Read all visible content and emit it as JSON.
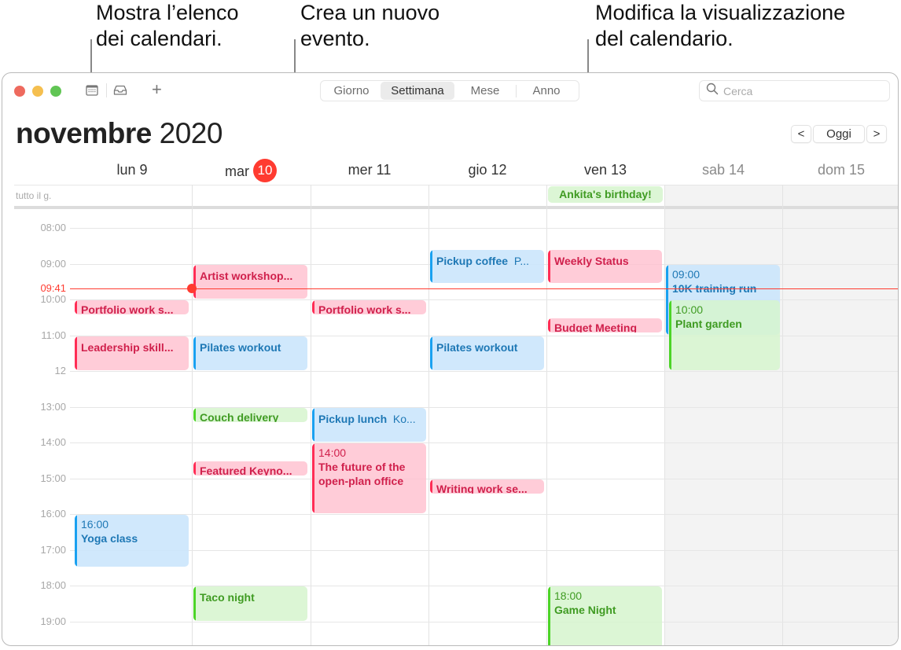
{
  "callouts": {
    "calendars_list": [
      "Mostra l’elenco",
      "dei calendari."
    ],
    "new_event": [
      "Crea un nuovo",
      "evento."
    ],
    "change_view": [
      "Modifica la visualizzazione",
      "del calendario."
    ]
  },
  "toolbar": {
    "calendars_icon": "calendar-list-icon",
    "inbox_icon": "inbox-tray-icon",
    "add_label": "+",
    "views": [
      "Giorno",
      "Settimana",
      "Mese",
      "Anno"
    ],
    "active_view": "Settimana",
    "search_placeholder": "Cerca"
  },
  "header": {
    "month": "novembre",
    "year": "2020",
    "prev_label": "<",
    "today_label": "Oggi",
    "next_label": ">"
  },
  "days": [
    {
      "name": "lun",
      "num": "9",
      "today": false,
      "weekend": false
    },
    {
      "name": "mar",
      "num": "10",
      "today": true,
      "weekend": false
    },
    {
      "name": "mer",
      "num": "11",
      "today": false,
      "weekend": false
    },
    {
      "name": "gio",
      "num": "12",
      "today": false,
      "weekend": false
    },
    {
      "name": "ven",
      "num": "13",
      "today": false,
      "weekend": false
    },
    {
      "name": "sab",
      "num": "14",
      "today": false,
      "weekend": true
    },
    {
      "name": "dom",
      "num": "15",
      "today": false,
      "weekend": true
    }
  ],
  "allday": {
    "label": "tutto il g.",
    "events": [
      {
        "day": 4,
        "title": "Ankita's birthday!",
        "color": "green"
      }
    ]
  },
  "hours": [
    "08:00",
    "09:00",
    "10:00",
    "11:00",
    "12",
    "13:00",
    "14:00",
    "15:00",
    "16:00",
    "17:00",
    "18:00",
    "19:00"
  ],
  "now": {
    "label": "09:41",
    "hour": 9.683
  },
  "colors": {
    "red": "#ff2d55",
    "blue": "#1aa1f0",
    "green": "#4cd427",
    "today": "#ff3b30"
  },
  "events": [
    {
      "day": 0,
      "start": 10.0,
      "end": 10.45,
      "title": "Portfolio work s...",
      "color": "red"
    },
    {
      "day": 0,
      "start": 11.0,
      "end": 12.0,
      "title": "Leadership skill...",
      "color": "red"
    },
    {
      "day": 0,
      "start": 16.0,
      "end": 17.5,
      "time": "16:00",
      "title": "Yoga class",
      "color": "blue"
    },
    {
      "day": 1,
      "start": 9.0,
      "end": 10.0,
      "title": "Artist workshop...",
      "color": "red"
    },
    {
      "day": 1,
      "start": 11.0,
      "end": 12.0,
      "title": "Pilates workout",
      "color": "blue"
    },
    {
      "day": 1,
      "start": 13.0,
      "end": 13.45,
      "title": "Couch delivery",
      "color": "green"
    },
    {
      "day": 1,
      "start": 14.5,
      "end": 14.95,
      "title": "Featured Keyno...",
      "color": "red"
    },
    {
      "day": 1,
      "start": 18.0,
      "end": 19.0,
      "title": "Taco night",
      "color": "green"
    },
    {
      "day": 2,
      "start": 10.0,
      "end": 10.45,
      "title": "Portfolio work s...",
      "color": "red"
    },
    {
      "day": 2,
      "start": 13.0,
      "end": 14.0,
      "title": "Pickup lunch",
      "location": "Ko...",
      "color": "blue"
    },
    {
      "day": 2,
      "start": 14.0,
      "end": 16.0,
      "time": "14:00",
      "title": "The future of the open-plan office",
      "color": "red",
      "wrap": true
    },
    {
      "day": 3,
      "start": 8.6,
      "end": 9.55,
      "title": "Pickup coffee",
      "location": "P...",
      "color": "blue"
    },
    {
      "day": 3,
      "start": 11.0,
      "end": 12.0,
      "title": "Pilates workout",
      "color": "blue"
    },
    {
      "day": 3,
      "start": 15.0,
      "end": 15.45,
      "title": "Writing work se...",
      "color": "red"
    },
    {
      "day": 4,
      "start": 8.6,
      "end": 9.55,
      "title": "Weekly Status",
      "color": "red"
    },
    {
      "day": 4,
      "start": 10.5,
      "end": 10.95,
      "title": "Budget Meeting",
      "color": "red"
    },
    {
      "day": 4,
      "start": 18.0,
      "end": 20.0,
      "time": "18:00",
      "title": "Game Night",
      "color": "green"
    },
    {
      "day": 5,
      "start": 9.0,
      "end": 11.0,
      "time": "09:00",
      "title": "10K training run",
      "color": "blue"
    },
    {
      "day": 5,
      "start": 10.0,
      "end": 12.0,
      "time": "10:00",
      "title": "Plant garden",
      "color": "green",
      "indent": true
    }
  ]
}
